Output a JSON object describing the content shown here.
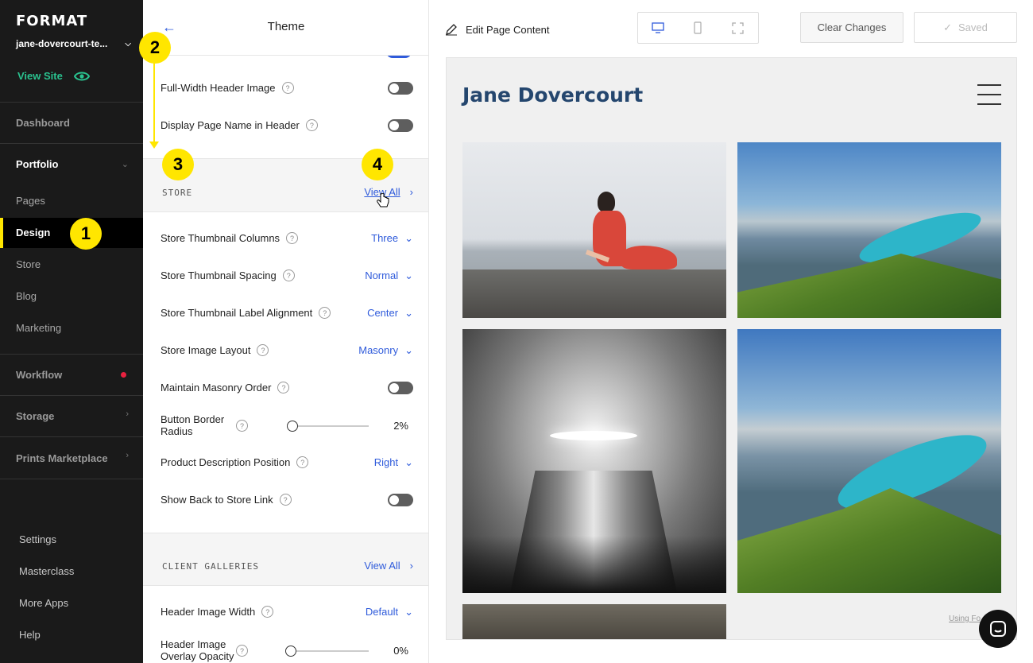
{
  "sidebar": {
    "logo": "FORMAT",
    "site_select": "jane-dovercourt-te...",
    "view_site": "View Site",
    "items": {
      "dashboard": "Dashboard",
      "portfolio": "Portfolio",
      "pages": "Pages",
      "design": "Design",
      "store": "Store",
      "blog": "Blog",
      "marketing": "Marketing",
      "workflow": "Workflow",
      "storage": "Storage",
      "prints_marketplace": "Prints Marketplace"
    },
    "bottom": {
      "settings": "Settings",
      "masterclass": "Masterclass",
      "more_apps": "More Apps",
      "help": "Help"
    }
  },
  "panel": {
    "title": "Theme",
    "top_rows": [
      {
        "label": "Full-Width Header Image"
      },
      {
        "label": "Display Page Name in Header"
      }
    ],
    "store_section": {
      "title": "STORE",
      "view_all": "View All",
      "rows": {
        "thumb_columns": {
          "label": "Store Thumbnail Columns",
          "value": "Three"
        },
        "thumb_spacing": {
          "label": "Store Thumbnail Spacing",
          "value": "Normal"
        },
        "label_alignment": {
          "label": "Store Thumbnail Label Alignment",
          "value": "Center"
        },
        "image_layout": {
          "label": "Store Image Layout",
          "value": "Masonry"
        },
        "masonry_order": {
          "label": "Maintain Masonry Order"
        },
        "border_radius": {
          "label_line1": "Button Border",
          "label_line2": "Radius",
          "value": "2%"
        },
        "desc_position": {
          "label": "Product Description Position",
          "value": "Right"
        },
        "back_link": {
          "label": "Show Back to Store Link"
        }
      }
    },
    "galleries_section": {
      "title": "CLIENT GALLERIES",
      "view_all": "View All",
      "rows": {
        "header_width": {
          "label": "Header Image Width",
          "value": "Default"
        },
        "overlay_opacity": {
          "label_line1": "Header Image",
          "label_line2": "Overlay Opacity",
          "value": "0%"
        }
      }
    }
  },
  "annotations": [
    "1",
    "2",
    "3",
    "4"
  ],
  "topbar": {
    "edit_label": "Edit Page Content",
    "clear_label": "Clear Changes",
    "saved_label": "Saved"
  },
  "preview": {
    "site_name": "Jane Dovercourt",
    "footer_text": "Using Fo"
  },
  "colors": {
    "accent": "#2f5bdb",
    "sidebar_bg": "#1a1a1a",
    "highlight": "#ffe600",
    "view_site": "#2ac28f",
    "site_name": "#24466e"
  }
}
